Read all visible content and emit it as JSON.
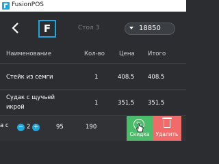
{
  "window": {
    "title": "FusionPOS"
  },
  "topbar": {
    "back_icon": "chevron-left-icon",
    "logo_letter": "F",
    "table_label": "Стол 3",
    "check_amount": "18850"
  },
  "columns": {
    "name": "Наименование",
    "qty": "Кол-во",
    "price": "Цена",
    "total": "Итого"
  },
  "rows": [
    {
      "name": "Стейк из семги",
      "qty": "1",
      "price": "408.5",
      "total": "408.5"
    },
    {
      "name_line1": "Судак с щучьей",
      "name_line2": "икрой",
      "qty": "1",
      "price": "351.5",
      "total": "351.5"
    },
    {
      "name_fragment": "а с",
      "qty": "2",
      "price": "95",
      "total": "190"
    }
  ],
  "actions": {
    "discount_label": "Скидка",
    "delete_label": "Удалить"
  },
  "colors": {
    "accent": "#1ba9e1",
    "discount": "#4bbd6a",
    "delete": "#f26b6b",
    "background": "#2b2d30"
  }
}
